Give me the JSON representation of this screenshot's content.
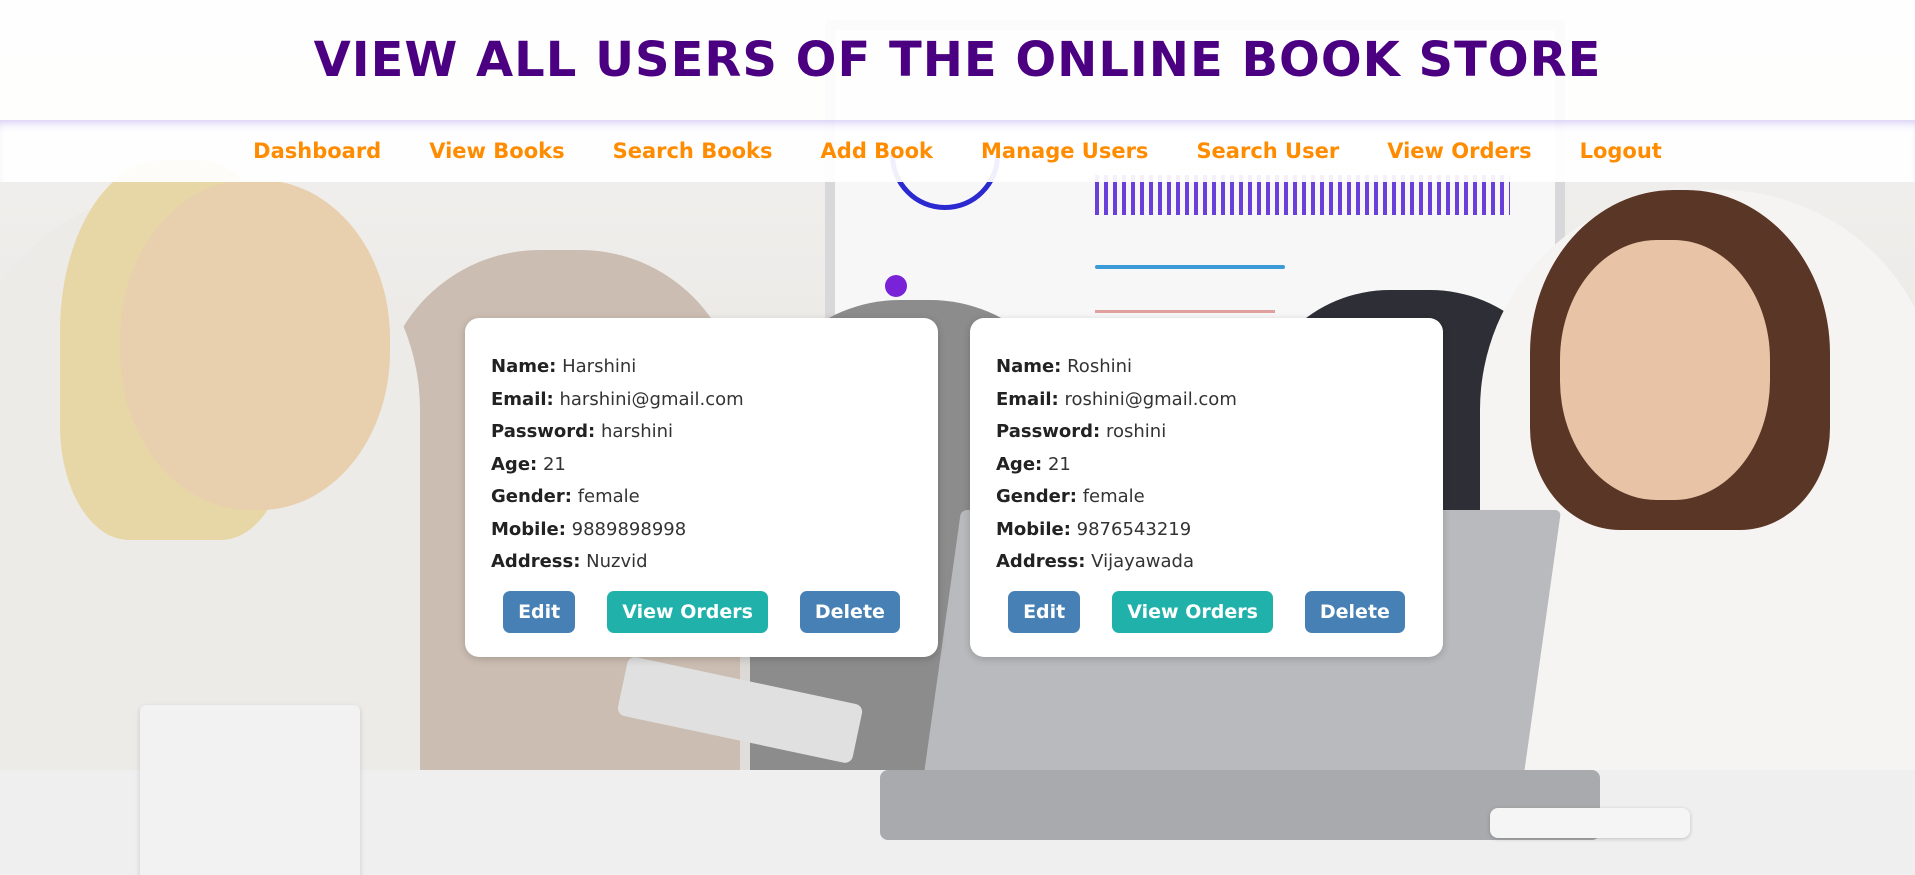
{
  "header": {
    "title": "VIEW ALL USERS OF THE ONLINE BOOK STORE"
  },
  "nav": {
    "items": [
      {
        "label": "Dashboard"
      },
      {
        "label": "View Books"
      },
      {
        "label": "Search Books"
      },
      {
        "label": "Add Book"
      },
      {
        "label": "Manage Users"
      },
      {
        "label": "Search User"
      },
      {
        "label": "View Orders"
      },
      {
        "label": "Logout"
      }
    ]
  },
  "field_labels": {
    "name": "Name:",
    "email": "Email:",
    "password": "Password:",
    "age": "Age:",
    "gender": "Gender:",
    "mobile": "Mobile:",
    "address": "Address:"
  },
  "users": [
    {
      "name": "Harshini",
      "email": "harshini@gmail.com",
      "password": "harshini",
      "age": "21",
      "gender": "female",
      "mobile": "9889898998",
      "address": "Nuzvid"
    },
    {
      "name": "Roshini",
      "email": "roshini@gmail.com",
      "password": "roshini",
      "age": "21",
      "gender": "female",
      "mobile": "9876543219",
      "address": "Vijayawada"
    }
  ],
  "buttons": {
    "edit": "Edit",
    "view_orders": "View Orders",
    "delete": "Delete"
  },
  "colors": {
    "title": "#4b0082",
    "nav_link": "#ff8c00",
    "button_blue": "#4680b4",
    "button_teal": "#20b2aa"
  }
}
